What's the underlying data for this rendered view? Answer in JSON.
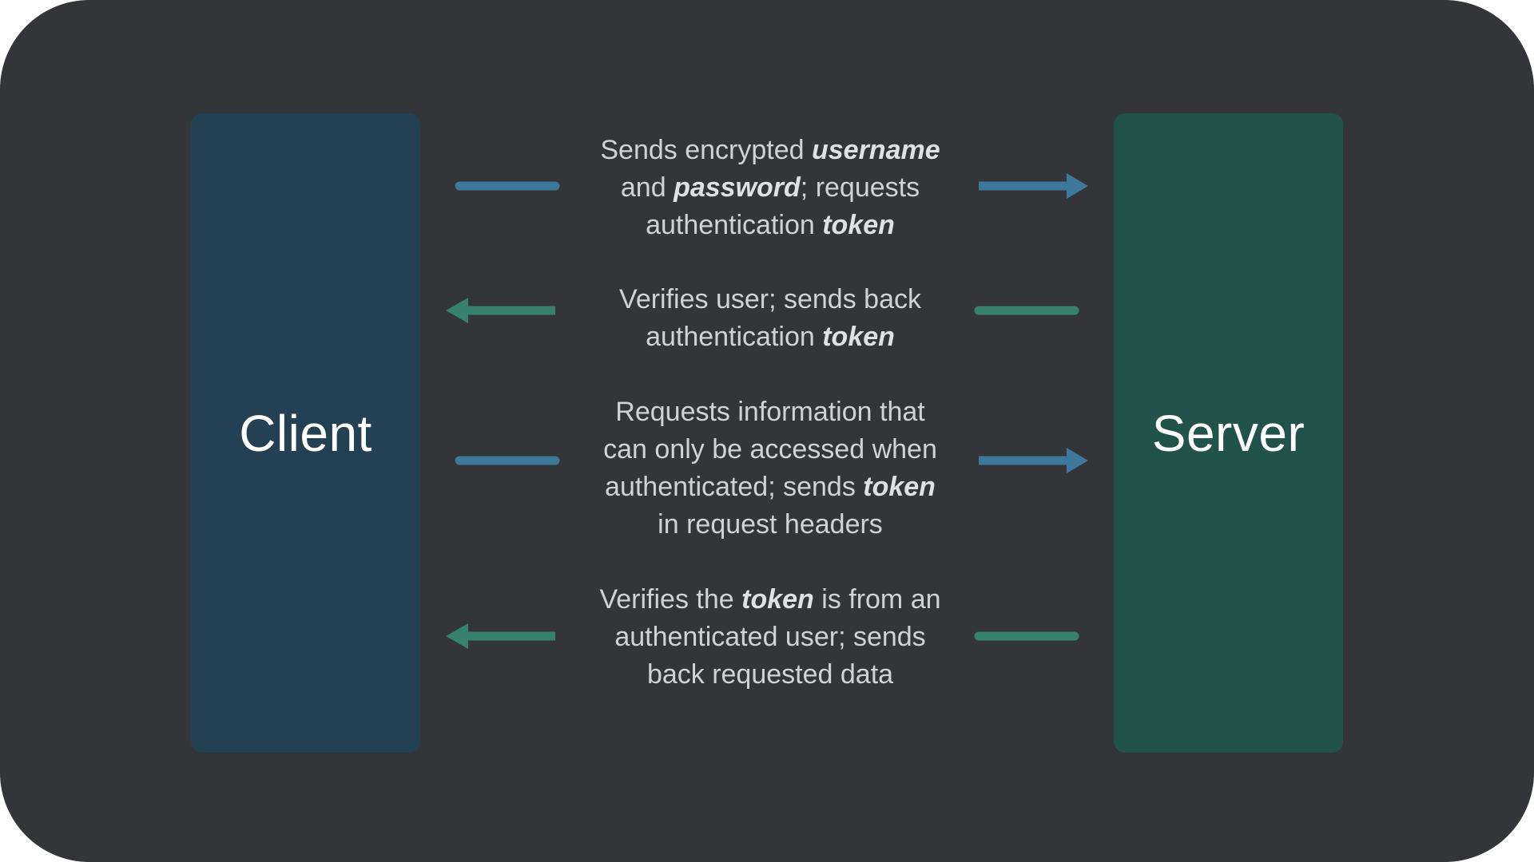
{
  "colors": {
    "background": "#343539",
    "client_box": "#234152",
    "server_box": "#22534b",
    "request_arrow": "#3e789a",
    "response_arrow": "#37816f",
    "text": "#cfd2d6"
  },
  "client": {
    "label": "Client"
  },
  "server": {
    "label": "Server"
  },
  "messages": [
    {
      "direction": "client-to-server",
      "lines": [
        [
          {
            "t": "Sends encrypted "
          },
          {
            "t": "username",
            "em": true
          }
        ],
        [
          {
            "t": "and "
          },
          {
            "t": "password",
            "em": true
          },
          {
            "t": "; requests"
          }
        ],
        [
          {
            "t": "authentication "
          },
          {
            "t": "token",
            "em": true
          }
        ]
      ]
    },
    {
      "direction": "server-to-client",
      "lines": [
        [
          {
            "t": "Verifies user; sends back"
          }
        ],
        [
          {
            "t": "authentication "
          },
          {
            "t": "token",
            "em": true
          }
        ]
      ]
    },
    {
      "direction": "client-to-server",
      "lines": [
        [
          {
            "t": "Requests information that"
          }
        ],
        [
          {
            "t": "can only be accessed when"
          }
        ],
        [
          {
            "t": "authenticated; sends "
          },
          {
            "t": "token",
            "em": true
          }
        ],
        [
          {
            "t": "in request headers"
          }
        ]
      ]
    },
    {
      "direction": "server-to-client",
      "lines": [
        [
          {
            "t": "Verifies the "
          },
          {
            "t": "token",
            "em": true
          },
          {
            "t": " is from an"
          }
        ],
        [
          {
            "t": "authenticated user; sends"
          }
        ],
        [
          {
            "t": "back requested data"
          }
        ]
      ]
    }
  ]
}
